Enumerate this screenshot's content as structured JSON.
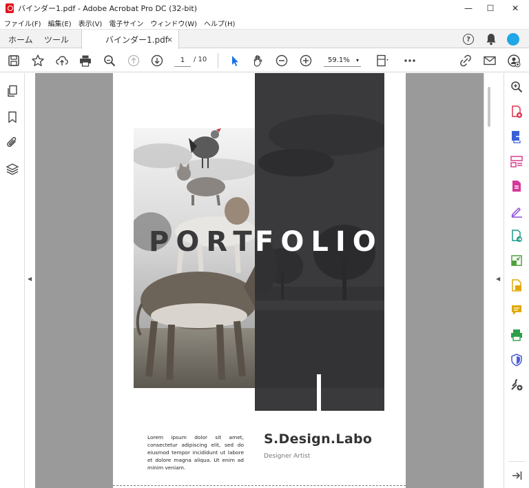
{
  "window": {
    "title": "バインダー1.pdf - Adobe Acrobat Pro DC (32-bit)",
    "minimize": "—",
    "maximize": "☐",
    "close": "✕"
  },
  "menu": [
    "ファイル(F)",
    "編集(E)",
    "表示(V)",
    "電子サイン",
    "ウィンドウ(W)",
    "ヘルプ(H)"
  ],
  "tabs": {
    "home": "ホーム",
    "tools": "ツール",
    "document": "バインダー1.pdf",
    "close": "×"
  },
  "header_icons": {
    "help": "?"
  },
  "toolbar": {
    "current_page": "1",
    "total_pages": "/  10",
    "zoom": "59.1%",
    "zoom_caret": "▾"
  },
  "colors": {
    "accent_blue": "#1a73e8",
    "avatar": "#1fa7e6",
    "dark_panel": "#3a3a3c"
  },
  "document": {
    "headline_left": "PORT",
    "headline_right": "FOLIO",
    "lorem": "Lorem ipsum dolor sit amet, consectetur adipiscing elit, sed do eiusmod tempor incididunt ut labore et dolore magna aliqua. Ut enim ad minim veniam.",
    "brand": "S.Design.Labo",
    "role": "Designer Artist"
  },
  "rails": {
    "collapse_left": "◀",
    "collapse_right": "◀"
  },
  "icons": {
    "left_rail": [
      "pages-icon",
      "bookmark-icon",
      "attachment-icon",
      "layers-icon"
    ],
    "right_rail": [
      "zoom-search-icon",
      "create-pdf-icon",
      "export-pdf-icon",
      "organize-pages-icon",
      "edit-pdf-icon",
      "fill-sign-icon",
      "combine-files-icon",
      "compress-icon",
      "send-comments-icon",
      "comment-icon",
      "print-production-icon",
      "protect-icon",
      "more-tools-icon",
      "collapse-panel-icon"
    ]
  }
}
